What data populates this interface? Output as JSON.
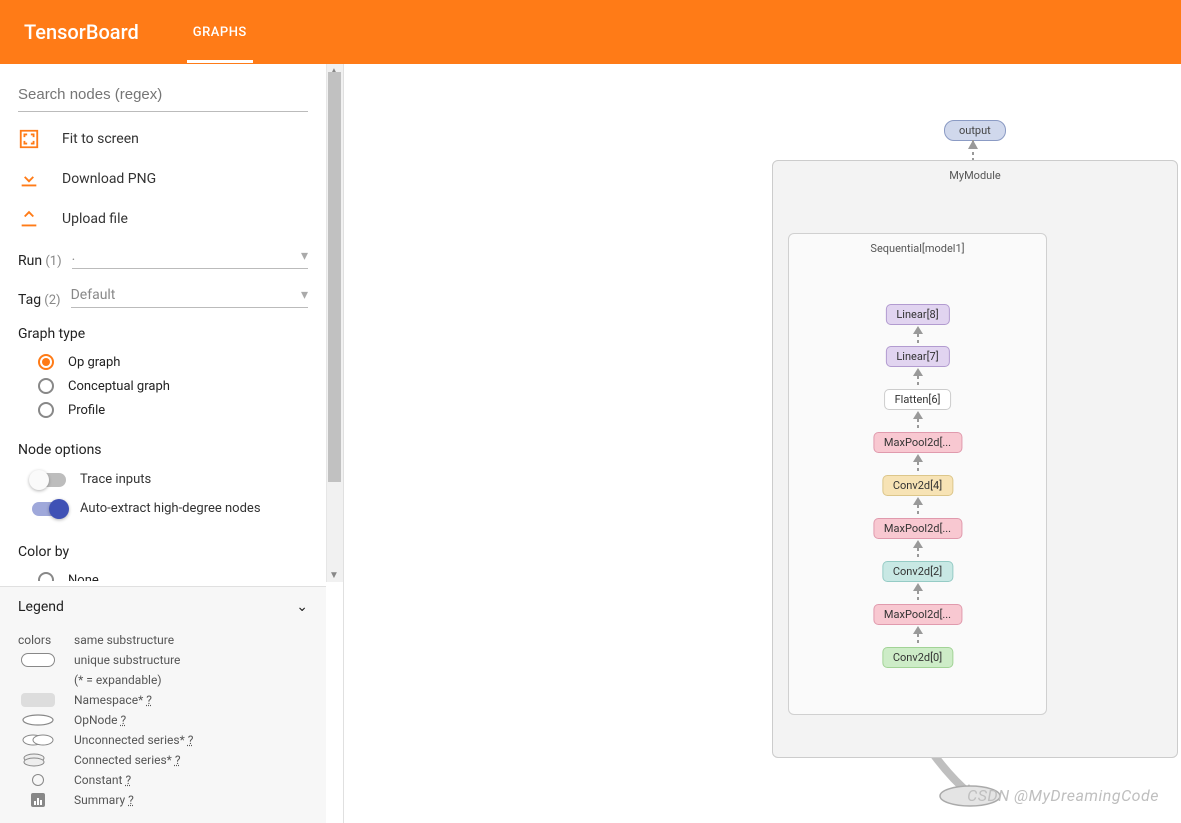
{
  "header": {
    "logo": "TensorBoard",
    "tab": "GRAPHS"
  },
  "sidebar": {
    "search_placeholder": "Search nodes (regex)",
    "actions": {
      "fit": "Fit to screen",
      "download": "Download PNG",
      "upload": "Upload file"
    },
    "run": {
      "label": "Run",
      "count": "(1)",
      "value": "."
    },
    "tag": {
      "label": "Tag",
      "count": "(2)",
      "value": "Default"
    },
    "graph_type": {
      "title": "Graph type",
      "options": {
        "op": "Op graph",
        "conceptual": "Conceptual graph",
        "profile": "Profile"
      },
      "selected": "op"
    },
    "node_options": {
      "title": "Node options",
      "trace": "Trace inputs",
      "auto_extract": "Auto-extract high-degree nodes"
    },
    "color_by": {
      "title": "Color by",
      "none": "None"
    }
  },
  "legend": {
    "title": "Legend",
    "colors_label": "colors",
    "same_sub": "same substructure",
    "unique_sub": "unique substructure",
    "expandable_note": "(* = expandable)",
    "namespace": "Namespace* ",
    "opnode": "OpNode ",
    "unconnected": "Unconnected series* ",
    "connected": "Connected series* ",
    "constant": "Constant ",
    "summary": "Summary ",
    "q": "?"
  },
  "graph": {
    "output": "output",
    "module": "MyModule",
    "sequential": "Sequential[model1]",
    "nodes": {
      "linear8": "Linear[8]",
      "linear7": "Linear[7]",
      "flatten6": "Flatten[6]",
      "maxpool5": "MaxPool2d[...",
      "conv4": "Conv2d[4]",
      "maxpool3": "MaxPool2d[...",
      "conv2": "Conv2d[2]",
      "maxpool1": "MaxPool2d[...",
      "conv0": "Conv2d[0]"
    }
  },
  "watermark": "CSDN @MyDreamingCode"
}
